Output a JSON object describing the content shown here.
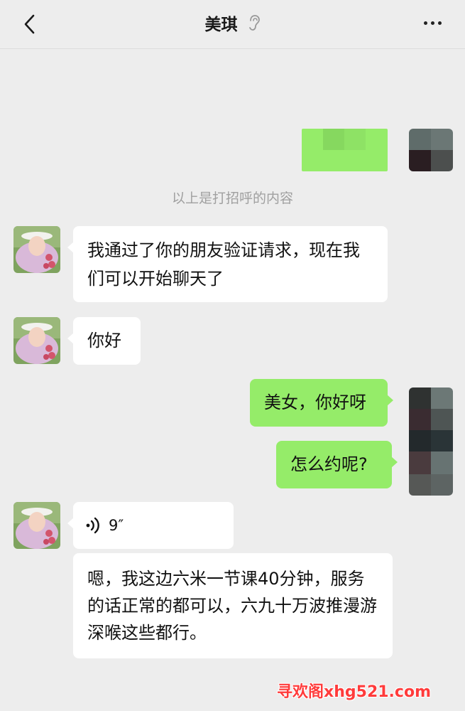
{
  "header": {
    "title": "美琪",
    "back_icon": "chevron-left-icon",
    "ear_icon": "ear-icon",
    "more_icon": "more-dots-icon"
  },
  "system_message": "以上是打招呼的内容",
  "messages": [
    {
      "side": "in",
      "text": "我通过了你的朋友验证请求，现在我们可以开始聊天了"
    },
    {
      "side": "in",
      "text": "你好"
    },
    {
      "side": "out",
      "text": "美女，你好呀"
    },
    {
      "side": "out",
      "text": "怎么约呢?"
    },
    {
      "side": "in",
      "type": "voice",
      "duration": "9″"
    },
    {
      "side": "in",
      "text": "嗯，我这边六米一节课40分钟，服务的话正常的都可以，六九十万波推漫游深喉这些都行。"
    }
  ],
  "watermark": "寻欢阁xhg521.com",
  "colors": {
    "background": "#ededed",
    "incoming_bubble": "#ffffff",
    "outgoing_bubble": "#95ec69",
    "system_text": "#a0a0a0",
    "watermark": "#ff3b3b"
  }
}
